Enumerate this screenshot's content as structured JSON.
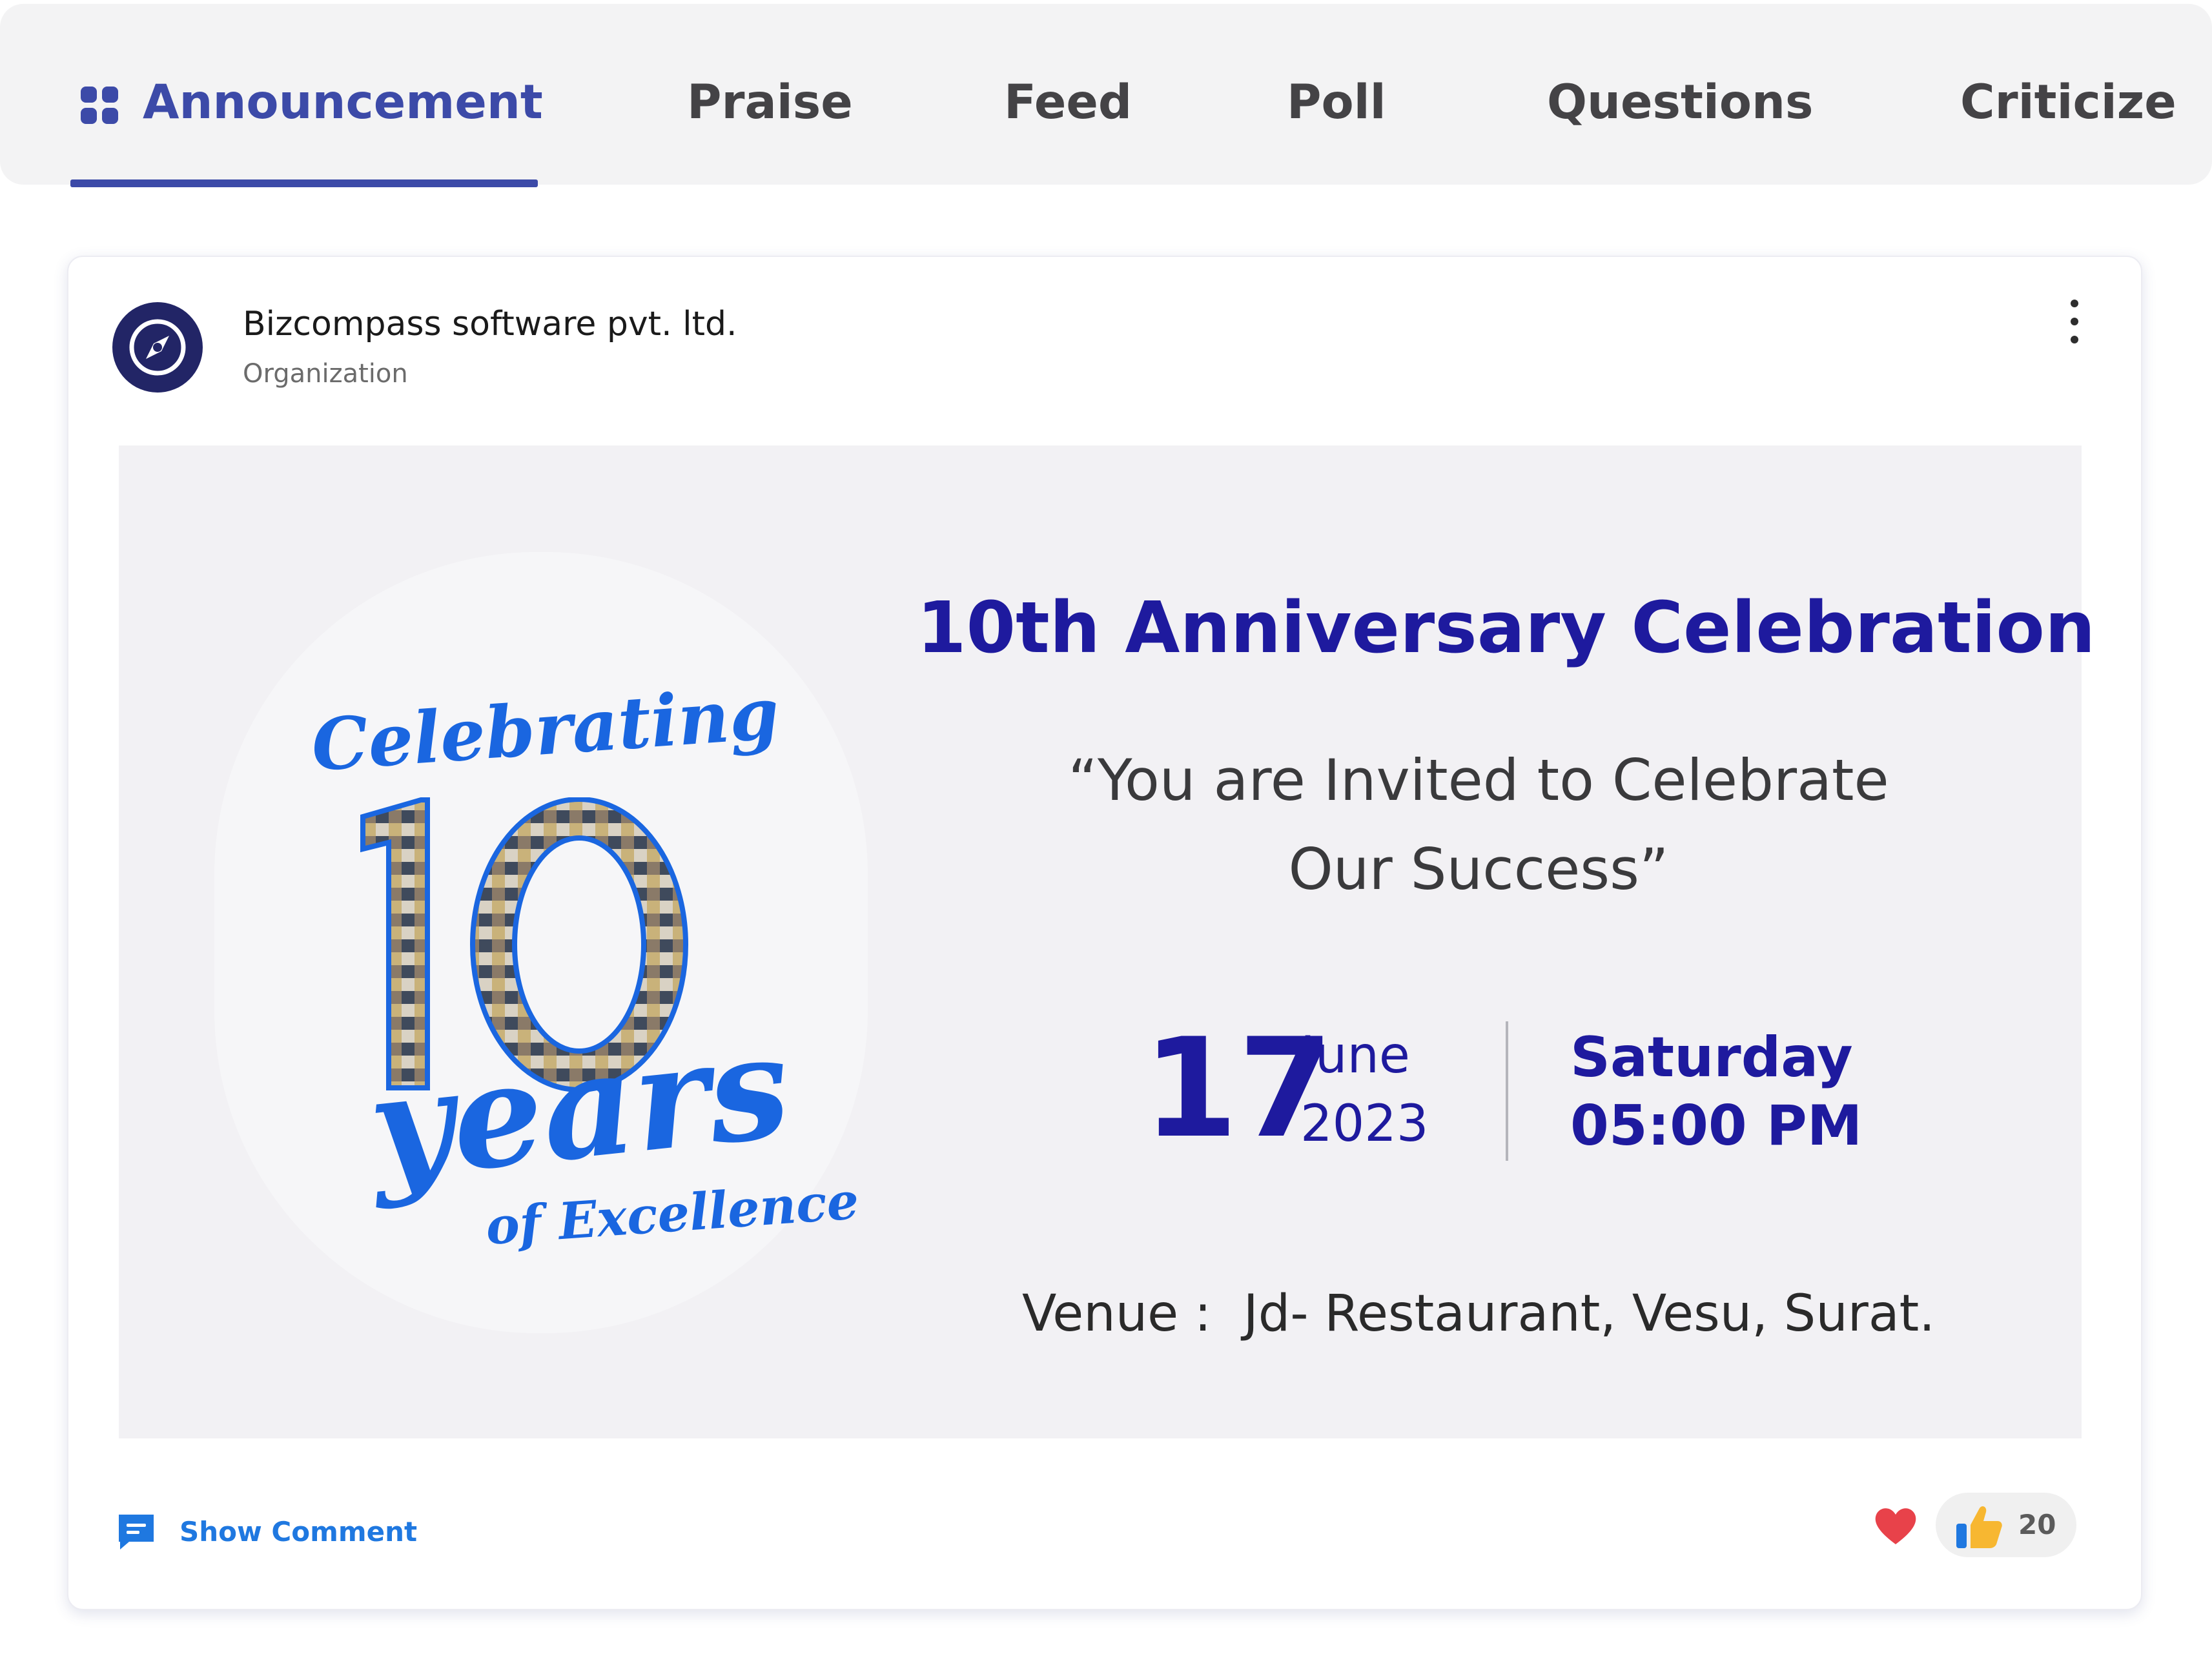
{
  "tabs": [
    {
      "label": "Announcement",
      "active": true,
      "icon": "grid-icon"
    },
    {
      "label": "Praise"
    },
    {
      "label": "Feed"
    },
    {
      "label": "Poll"
    },
    {
      "label": "Questions"
    },
    {
      "label": "Criticize"
    }
  ],
  "post": {
    "author": "Bizcompass software pvt. ltd.",
    "author_type": "Organization",
    "avatar_icon": "compass-icon",
    "menu_icon": "more-vertical-icon"
  },
  "banner": {
    "emblem": {
      "line1": "Celebrating",
      "number": "10",
      "line2": "years",
      "line3": "of Excellence"
    },
    "title": "10th Anniversary Celebration",
    "invite_line1": "“You are Invited to Celebrate",
    "invite_line2": "Our Success”",
    "day": "17",
    "month": "June",
    "year": "2023",
    "weekday": "Saturday",
    "time": "05:00 PM",
    "venue_label": "Venue :",
    "venue": "Jd- Restaurant, Vesu, Surat."
  },
  "footer": {
    "comment_icon": "comment-icon",
    "show_comment": "Show Comment",
    "heart_icon": "heart-icon",
    "like_icon": "thumbs-up-icon",
    "like_count": "20"
  },
  "colors": {
    "accent": "#3c4aa8",
    "title_blue": "#1e1a9e",
    "script_blue": "#1a66e0",
    "link_blue": "#1f78e0",
    "heart_red": "#e8424a",
    "like_yellow": "#f7b731"
  }
}
